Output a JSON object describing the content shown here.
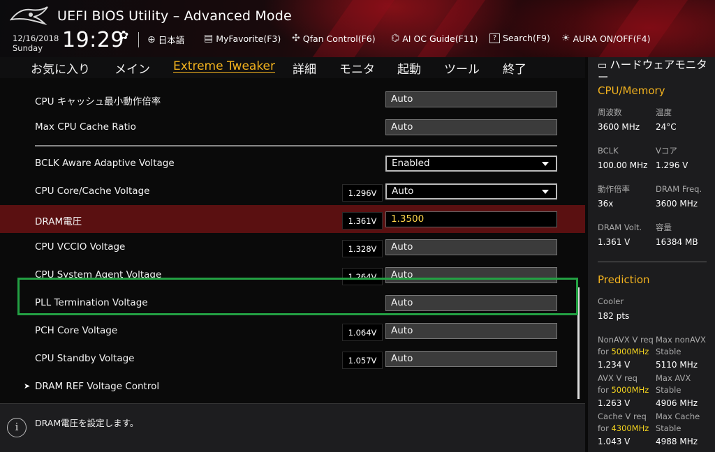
{
  "header": {
    "title": "UEFI BIOS Utility – Advanced Mode",
    "date": "12/16/2018",
    "day": "Sunday",
    "time": "19:29",
    "items": [
      {
        "icon": "globe-icon",
        "label": "日本語"
      },
      {
        "icon": "favorite-icon",
        "label": "MyFavorite(F3)"
      },
      {
        "icon": "fan-icon",
        "label": "Qfan Control(F6)"
      },
      {
        "icon": "ai-oc-icon",
        "label": "AI OC Guide(F11)"
      },
      {
        "icon": "search-icon",
        "label": "Search(F9)"
      },
      {
        "icon": "aura-icon",
        "label": "AURA ON/OFF(F4)"
      }
    ]
  },
  "menu": {
    "tabs": [
      "お気に入り",
      "メイン",
      "Extreme Tweaker",
      "詳細",
      "モニタ",
      "起動",
      "ツール",
      "終了"
    ],
    "active": "Extreme Tweaker"
  },
  "settings": [
    {
      "label": "CPU キャッシュ最小動作倍率",
      "voltage": "",
      "value": "Auto",
      "type": "field"
    },
    {
      "label": "Max CPU Cache Ratio",
      "voltage": "",
      "value": "Auto",
      "type": "field"
    },
    {
      "label": "BCLK Aware Adaptive Voltage",
      "voltage": "",
      "value": "Enabled",
      "type": "dropdown"
    },
    {
      "label": "CPU Core/Cache Voltage",
      "voltage": "1.296V",
      "value": "Auto",
      "type": "dropdown"
    },
    {
      "label": "DRAM電圧",
      "voltage": "1.361V",
      "value": "1.3500",
      "type": "edit"
    },
    {
      "label": "CPU VCCIO Voltage",
      "voltage": "1.328V",
      "value": "Auto",
      "type": "field"
    },
    {
      "label": "CPU System Agent Voltage",
      "voltage": "1.264V",
      "value": "Auto",
      "type": "field"
    },
    {
      "label": "PLL Termination Voltage",
      "voltage": "",
      "value": "Auto",
      "type": "field"
    },
    {
      "label": "PCH Core Voltage",
      "voltage": "1.064V",
      "value": "Auto",
      "type": "field"
    },
    {
      "label": "CPU Standby Voltage",
      "voltage": "1.057V",
      "value": "Auto",
      "type": "field"
    },
    {
      "label": "DRAM REF Voltage Control",
      "voltage": "",
      "value": "",
      "type": "submenu"
    }
  ],
  "footer": {
    "help": "DRAM電圧を設定します。"
  },
  "monitor": {
    "title": "ハードウェアモニター",
    "cpu_section": "CPU/Memory",
    "cpu": [
      {
        "label": "周波数",
        "value": "3600 MHz"
      },
      {
        "label": "温度",
        "value": "24°C"
      },
      {
        "label": "BCLK",
        "value": "100.00 MHz"
      },
      {
        "label": "Vコア",
        "value": "1.296 V"
      },
      {
        "label": "動作倍率",
        "value": "36x"
      },
      {
        "label": "DRAM Freq.",
        "value": "3600 MHz"
      },
      {
        "label": "DRAM Volt.",
        "value": "1.361 V"
      },
      {
        "label": "容量",
        "value": "16384 MB"
      }
    ],
    "prediction_section": "Prediction",
    "cooler_label": "Cooler",
    "cooler_value": "182 pts",
    "predictions": [
      {
        "l1": "NonAVX V req",
        "l2pre": "for ",
        "freq": "5000MHz",
        "value": "1.234 V",
        "r1": "Max nonAVX",
        "r2": "Stable",
        "rvalue": "5110 MHz"
      },
      {
        "l1": "AVX V req",
        "l2pre": "for ",
        "freq": "5000MHz",
        "value": "1.263 V",
        "r1": "Max AVX",
        "r2": "Stable",
        "rvalue": "4906 MHz"
      },
      {
        "l1": "Cache V req",
        "l2pre": "for ",
        "freq": "4300MHz",
        "value": "1.043 V",
        "r1": "Max Cache",
        "r2": "Stable",
        "rvalue": "4988 MHz"
      }
    ]
  },
  "colors": {
    "accent": "#f2b21e",
    "selected_row": "#5a1011",
    "highlight_box": "#23a043",
    "edit_text": "#ffd54a"
  }
}
